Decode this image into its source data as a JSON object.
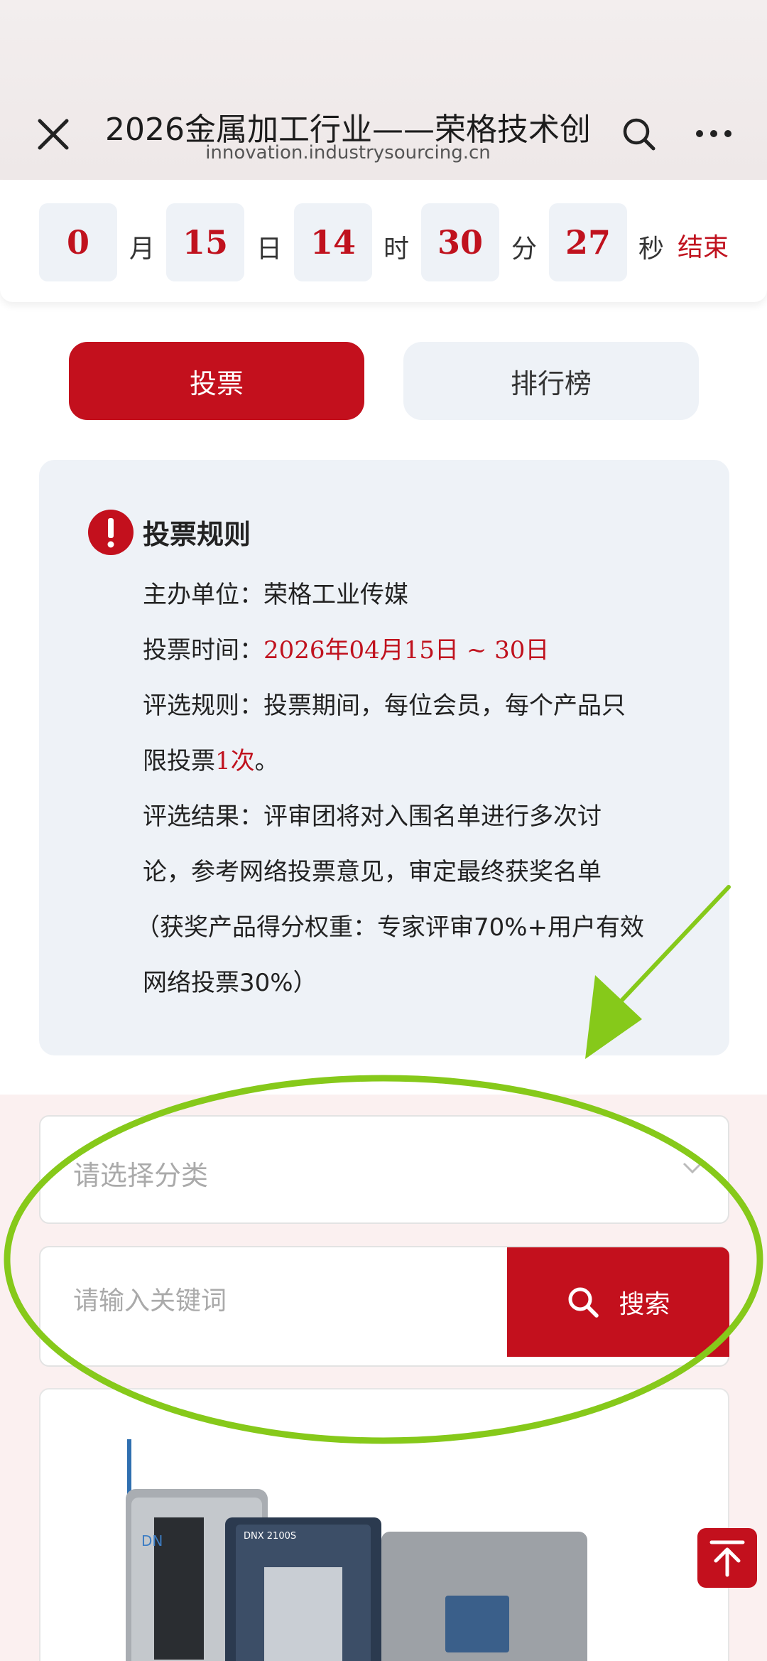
{
  "header": {
    "title": "2026金属加工行业——荣格技术创",
    "url": "innovation.industrysourcing.cn"
  },
  "countdown": {
    "months": "0",
    "month_unit": "月",
    "days": "15",
    "day_unit": "日",
    "hours": "14",
    "hour_unit": "时",
    "minutes": "30",
    "minute_unit": "分",
    "seconds": "27",
    "second_unit": "秒",
    "end_label": "结束"
  },
  "tabs": {
    "vote": "投票",
    "rank": "排行榜"
  },
  "rules": {
    "title": "投票规则",
    "organizer_label": "主办单位：",
    "organizer": "荣格工业传媒",
    "time_label": "投票时间：",
    "time": "2026年04月15日 ~ 30日",
    "rule_label": "评选规则：",
    "rule_text_1": "投票期间，每位会员，每个产品只",
    "rule_text_2a": "限投票",
    "rule_text_2b": "1次",
    "rule_text_2c": "。",
    "result_label": "评选结果：",
    "result_text_1": "评审团将对入围名单进行多次讨",
    "result_text_2": "论，参考网络投票意见，审定最终获奖名单",
    "result_text_3": "（获奖产品得分权重：专家评审70%+用户有效",
    "result_text_4": "网络投票30%）"
  },
  "filter": {
    "category_placeholder": "请选择分类",
    "keyword_placeholder": "请输入关键词",
    "search_label": "搜索"
  },
  "product": {
    "brand_text": "DN",
    "model_text": "DNX 2100S"
  },
  "colors": {
    "accent": "#c3101d",
    "panel": "#eef2f7",
    "annotation": "#86c91a"
  }
}
